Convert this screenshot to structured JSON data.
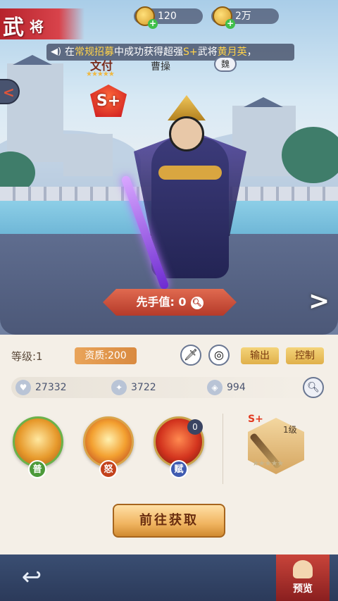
{
  "header": {
    "title_char1": "武",
    "title_char2": "将",
    "currency": [
      {
        "name": "gold-ingot",
        "value": "120"
      },
      {
        "name": "copper-coin",
        "value": "2万"
      }
    ]
  },
  "marquee": {
    "prefix": "在",
    "source": "常规招募",
    "middle": "中成功获得超强",
    "grade": "S+",
    "middle2": "武将",
    "hero": "黄月英",
    "suffix": "，"
  },
  "hero": {
    "faction_tag_text": "文付",
    "name": "曹操",
    "kingdom": "魏",
    "grade": "S+",
    "first_move_label": "先手值: 0"
  },
  "stats": {
    "level_label": "等级:1",
    "aptitude_label": "资质:200",
    "role_tags": [
      "输出",
      "控制"
    ],
    "hp": "27332",
    "attack": "3722",
    "defense": "994"
  },
  "skills": [
    {
      "type": "normal",
      "badge": "普"
    },
    {
      "type": "rage",
      "badge": "怒"
    },
    {
      "type": "talent",
      "badge": "赋",
      "count": "0"
    }
  ],
  "weapon": {
    "grade": "S+",
    "level": "1级",
    "stars": "★★★★★"
  },
  "actions": {
    "goto_label": "前往获取",
    "preview_label": "预览"
  },
  "icons": {
    "speaker": "speaker-icon",
    "sword": "sword-icon",
    "dragon": "dragon-emblem-icon",
    "heart": "heart-icon",
    "attack": "attack-icon",
    "shield": "shield-icon",
    "search": "search-icon",
    "back": "back-arrow-icon"
  }
}
